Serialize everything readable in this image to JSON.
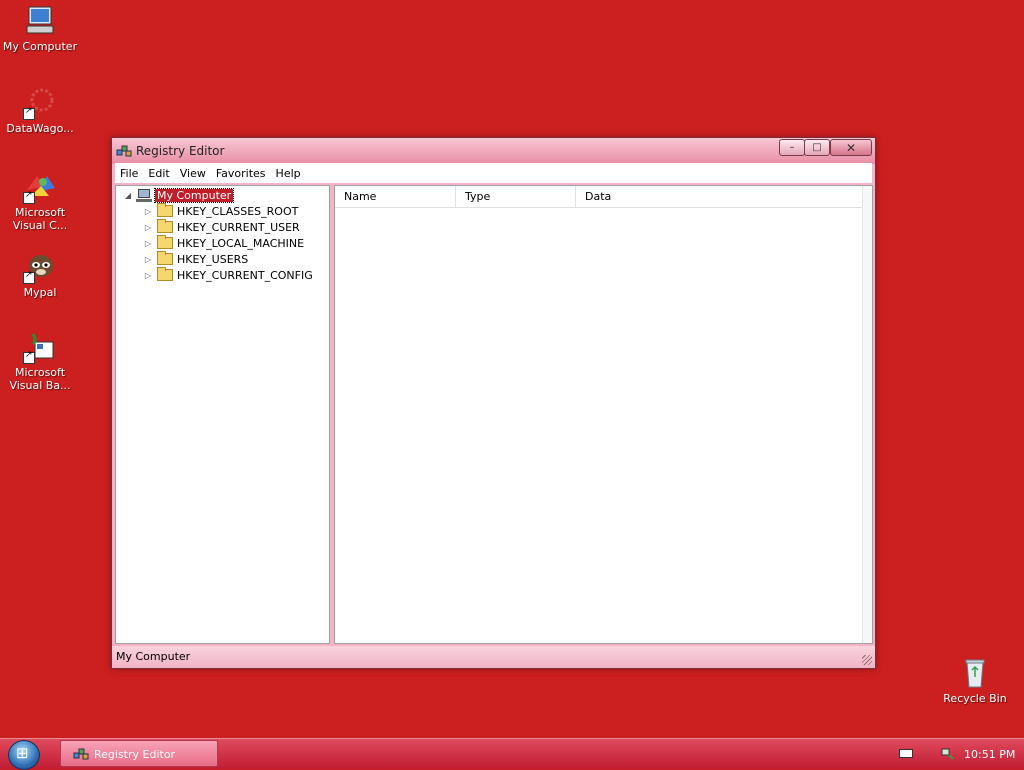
{
  "desktop": {
    "icons": [
      {
        "label": "My Computer",
        "icon": "my-computer-icon"
      },
      {
        "label": "DataWago...",
        "icon": "datawagon-icon"
      },
      {
        "label": "Microsoft Visual C...",
        "icon": "visual-c-icon"
      },
      {
        "label": "Mypal",
        "icon": "mypal-icon"
      },
      {
        "label": "Microsoft Visual Ba...",
        "icon": "visual-basic-icon"
      },
      {
        "label": "Recycle Bin",
        "icon": "recycle-bin-icon"
      }
    ]
  },
  "window": {
    "title": "Registry Editor",
    "buttons": {
      "minimize": "–",
      "maximize": "□",
      "close": "✕"
    },
    "menu": [
      "File",
      "Edit",
      "View",
      "Favorites",
      "Help"
    ],
    "tree": {
      "root": "My Computer",
      "children": [
        "HKEY_CLASSES_ROOT",
        "HKEY_CURRENT_USER",
        "HKEY_LOCAL_MACHINE",
        "HKEY_USERS",
        "HKEY_CURRENT_CONFIG"
      ]
    },
    "list_columns": [
      "Name",
      "Type",
      "Data"
    ],
    "status": "My Computer"
  },
  "taskbar": {
    "task_label": "Registry Editor",
    "clock": "10:51 PM"
  },
  "colors": {
    "desktop": "#cc1f1f",
    "selection": "#c01f2a"
  }
}
